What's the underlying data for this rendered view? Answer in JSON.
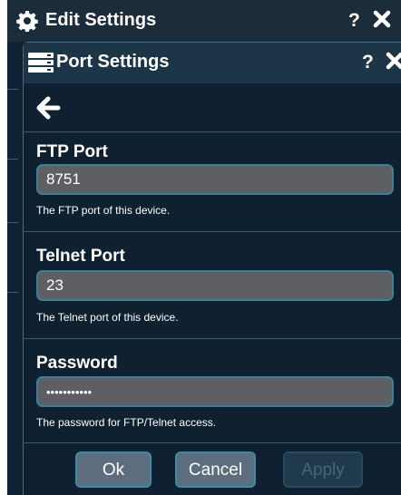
{
  "outer_window": {
    "title": "Edit Settings",
    "help": "?",
    "icon": "gear-icon",
    "close_icon": "close-icon"
  },
  "inner_window": {
    "title": "Port Settings",
    "help": "?",
    "icon": "server-icon",
    "close_icon": "close-icon"
  },
  "back_icon": "arrow-left-icon",
  "fields": {
    "ftp": {
      "label": "FTP Port",
      "value": "8751",
      "description": "The FTP port of this device."
    },
    "telnet": {
      "label": "Telnet Port",
      "value": "23",
      "description": "The Telnet port of this device."
    },
    "password": {
      "label": "Password",
      "value": "•••••••••••",
      "description": "The password for FTP/Telnet access."
    }
  },
  "buttons": {
    "ok": "Ok",
    "cancel": "Cancel",
    "apply": "Apply"
  },
  "colors": {
    "background": "#0f2030",
    "input": "#5d5f62",
    "input_border": "#3b7f98",
    "button": "#5c6e7d",
    "button_disabled": "#203a4d"
  }
}
